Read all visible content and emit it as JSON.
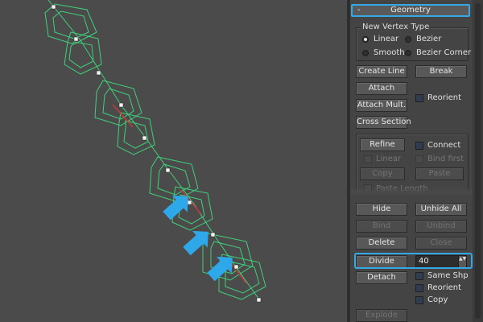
{
  "panel": {
    "rollout_title": "Geometry",
    "collapse_symbol": "-",
    "new_vertex_type": {
      "title": "New Vertex Type",
      "options": [
        {
          "label": "Linear",
          "selected": true
        },
        {
          "label": "Bezier",
          "selected": false
        },
        {
          "label": "Smooth",
          "selected": false
        },
        {
          "label": "Bezier Corner",
          "selected": false
        }
      ]
    },
    "buttons": {
      "create_line": "Create Line",
      "break": "Break",
      "attach": "Attach",
      "attach_mult": "Attach Mult.",
      "cross_section": "Cross Section",
      "refine": "Refine",
      "copy": "Copy",
      "paste": "Paste",
      "hide": "Hide",
      "unhide_all": "Unhide All",
      "bind": "Bind",
      "unbind": "Unbind",
      "delete": "Delete",
      "close": "Close",
      "divide": "Divide",
      "detach": "Detach",
      "explode": "Explode"
    },
    "checkboxes": {
      "reorient_attach": "Reorient",
      "connect": "Connect",
      "linear": "Linear",
      "bind_first": "Bind first",
      "paste_length": "Paste Length",
      "same_shp": "Same Shp",
      "reorient_detach": "Reorient",
      "copy": "Copy"
    },
    "divide_count": "40",
    "spinner_arrows": "▲▼"
  },
  "colors": {
    "highlight": "#35a8e6",
    "spline": "#3fd17a",
    "viewport_bg": "#4b4b4b"
  }
}
